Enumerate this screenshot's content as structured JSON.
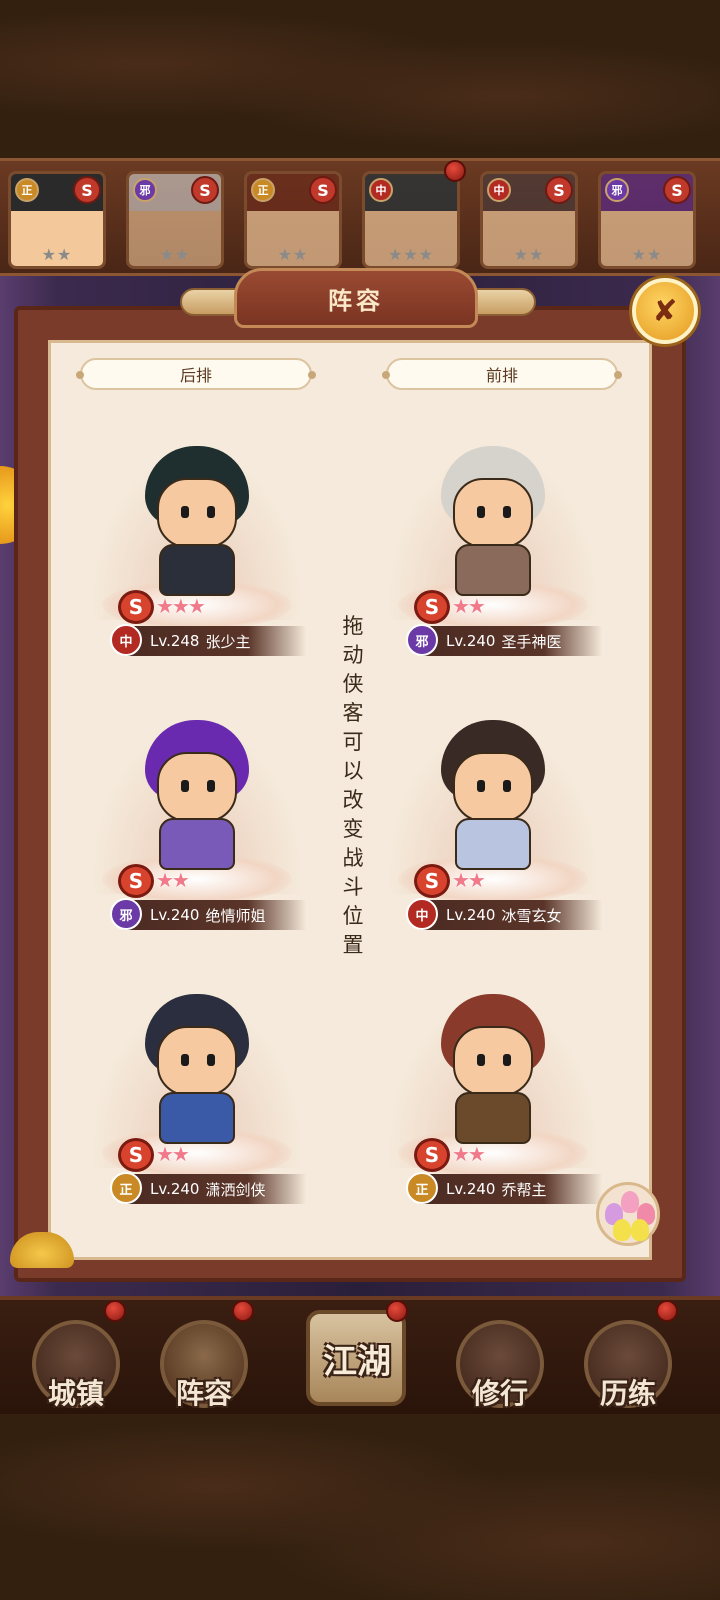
{
  "top_heroes": [
    {
      "faction": "正",
      "stars": "★★",
      "hair": "#2a2a2a",
      "skin": "#f3c99c"
    },
    {
      "faction": "邪",
      "stars": "★★",
      "hair": "#d8d8d8",
      "skin": "#f3c99c"
    },
    {
      "faction": "正",
      "stars": "★★",
      "hair": "#6b2a1a",
      "skin": "#f3c99c"
    },
    {
      "faction": "中",
      "stars": "★★★",
      "hair": "#22333a",
      "skin": "#f3c99c"
    },
    {
      "faction": "中",
      "stars": "★★",
      "hair": "#4a3a3a",
      "skin": "#f3c99c"
    },
    {
      "faction": "邪",
      "stars": "★★",
      "hair": "#5a2a8a",
      "skin": "#f3c99c"
    }
  ],
  "panel": {
    "title": "阵容",
    "close_icon": "✘",
    "back_row_label": "后排",
    "front_row_label": "前排",
    "hint": "拖动侠客可以改变战斗位置"
  },
  "formation": {
    "back": [
      {
        "faction": "中",
        "level": "Lv.248",
        "name": "张少主",
        "stars": "★★★",
        "hair": "#1f2e2e",
        "outfit": "#2a2f3a"
      },
      {
        "faction": "邪",
        "level": "Lv.240",
        "name": "绝情师姐",
        "stars": "★★",
        "hair": "#6a2ab0",
        "outfit": "#7a5ab8"
      },
      {
        "faction": "正",
        "level": "Lv.240",
        "name": "潇洒剑侠",
        "stars": "★★",
        "hair": "#2a2e3e",
        "outfit": "#3a5aa8"
      }
    ],
    "front": [
      {
        "faction": "邪",
        "level": "Lv.240",
        "name": "圣手神医",
        "stars": "★★",
        "hair": "#d6d2cc",
        "outfit": "#8a6a5a"
      },
      {
        "faction": "中",
        "level": "Lv.240",
        "name": "冰雪玄女",
        "stars": "★★",
        "hair": "#3a2a26",
        "outfit": "#b8c4e0"
      },
      {
        "faction": "正",
        "level": "Lv.240",
        "name": "乔帮主",
        "stars": "★★",
        "hair": "#8a3a2a",
        "outfit": "#6a4a2a"
      }
    ]
  },
  "nav": {
    "items": [
      {
        "label": "城镇"
      },
      {
        "label": "阵容"
      },
      {
        "label": "江湖"
      },
      {
        "label": "修行"
      },
      {
        "label": "历练"
      }
    ]
  },
  "s_mark": "S",
  "colors": {
    "panel_bg": "#f5eadb",
    "frame": "#7a3b2a",
    "star": "#f07a8a"
  }
}
